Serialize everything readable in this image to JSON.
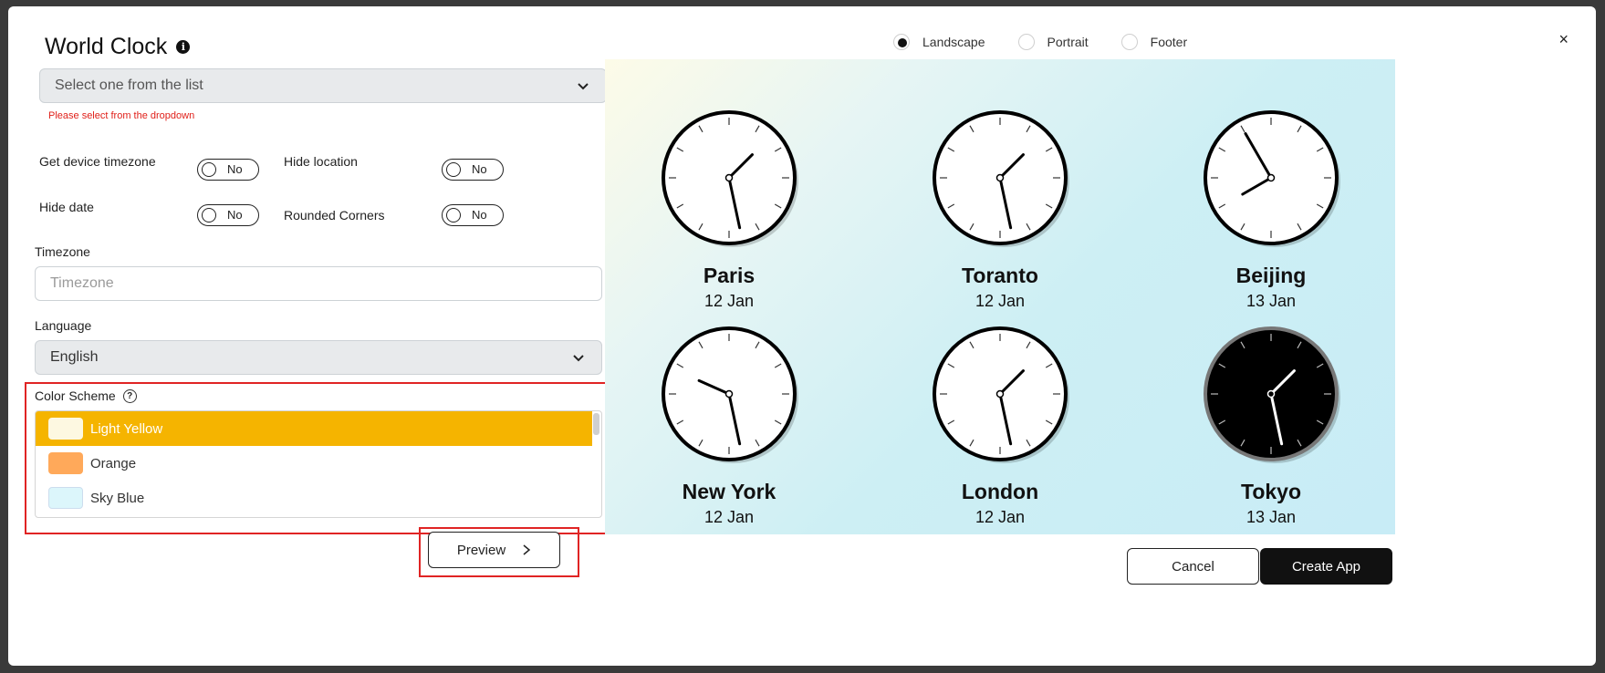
{
  "header": {
    "title": "World Clock",
    "close": "×",
    "orientation": [
      {
        "label": "Landscape",
        "selected": true
      },
      {
        "label": "Portrait",
        "selected": false
      },
      {
        "label": "Footer",
        "selected": false
      }
    ]
  },
  "form": {
    "clock_select": {
      "placeholder": "Select one from the list",
      "error": "Please select from the dropdown"
    },
    "toggles": {
      "device_tz": {
        "label": "Get device timezone",
        "value": "No"
      },
      "hide_location": {
        "label": "Hide location",
        "value": "No"
      },
      "hide_date": {
        "label": "Hide date",
        "value": "No"
      },
      "rounded": {
        "label": "Rounded Corners",
        "value": "No"
      }
    },
    "timezone": {
      "label": "Timezone",
      "placeholder": "Timezone",
      "value": ""
    },
    "language": {
      "label": "Language",
      "value": "English"
    },
    "color_scheme": {
      "label": "Color Scheme",
      "options": [
        {
          "label": "Light Yellow",
          "color": "#fdf8e1",
          "selected": true
        },
        {
          "label": "Orange",
          "color": "#ffa95a",
          "selected": false
        },
        {
          "label": "Sky Blue",
          "color": "#dcf6fb",
          "selected": false
        }
      ],
      "highlight_color": "#f5b400"
    },
    "preview_label": "Preview"
  },
  "clocks": [
    {
      "city": "Paris",
      "date": "12 Jan",
      "hour": 1.5,
      "minute": 28,
      "theme": "light"
    },
    {
      "city": "Toranto",
      "date": "12 Jan",
      "hour": 1.5,
      "minute": 28,
      "theme": "light"
    },
    {
      "city": "Beijing",
      "date": "13 Jan",
      "hour": 8,
      "minute": 55,
      "theme": "light"
    },
    {
      "city": "New York",
      "date": "12 Jan",
      "hour": 9.8,
      "minute": 28,
      "theme": "light"
    },
    {
      "city": "London",
      "date": "12 Jan",
      "hour": 1.5,
      "minute": 28,
      "theme": "light"
    },
    {
      "city": "Tokyo",
      "date": "13 Jan",
      "hour": 1.5,
      "minute": 28,
      "theme": "dark"
    }
  ],
  "footer": {
    "cancel": "Cancel",
    "create": "Create App"
  },
  "colors": {
    "accent": "#f5b400",
    "error": "#e02424",
    "primary_button": "#111111"
  }
}
